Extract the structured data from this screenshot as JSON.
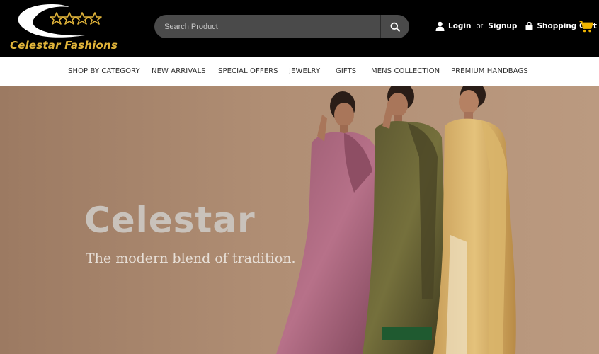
{
  "brand": {
    "name": "Celestar Fashions",
    "color": "#e2b53a"
  },
  "search": {
    "placeholder": "Search Product",
    "icon": "search-icon"
  },
  "account": {
    "login": "Login",
    "or": "or",
    "signup": "Signup",
    "cart": "Shopping Cart"
  },
  "nav": {
    "items": [
      {
        "label": "SHOP BY CATEGORY"
      },
      {
        "label": "NEW ARRIVALS"
      },
      {
        "label": "SPECIAL OFFERS"
      },
      {
        "label": "JEWELRY"
      },
      {
        "label": "GIFTS"
      },
      {
        "label": "MENS COLLECTION"
      },
      {
        "label": "PREMIUM HANDBAGS"
      }
    ]
  },
  "hero": {
    "title": "Celestar",
    "subtitle": "The modern blend of tradition.",
    "image": "three women wearing silk sarees"
  },
  "colors": {
    "header_bg": "#000000",
    "accent_gold": "#e2b53a",
    "cart_icon": "#f0b400",
    "hero_bg": "#a5846a"
  }
}
